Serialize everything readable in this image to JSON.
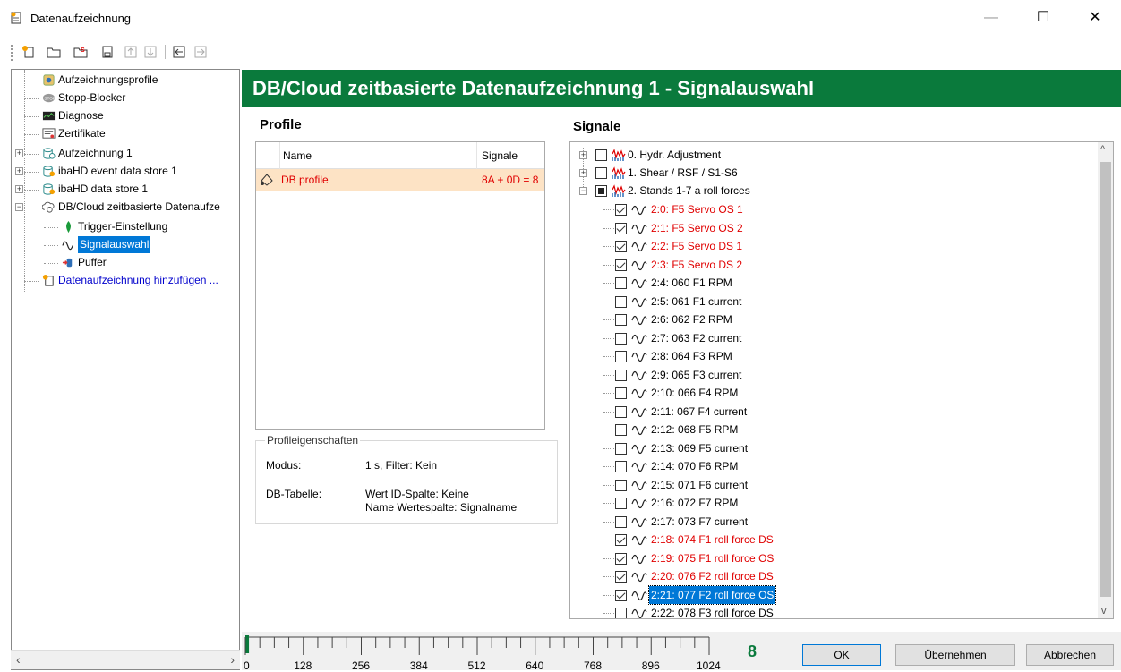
{
  "window": {
    "title": "Datenaufzeichnung",
    "minimize": "—",
    "maximize": "☐",
    "close": "✕"
  },
  "tree": {
    "items": [
      {
        "label": "Aufzeichnungsprofile",
        "color": "#000"
      },
      {
        "label": "Stopp-Blocker",
        "color": "#000"
      },
      {
        "label": "Diagnose",
        "color": "#000"
      },
      {
        "label": "Zertifikate",
        "color": "#000"
      },
      {
        "label": "Aufzeichnung 1",
        "color": "#000"
      },
      {
        "label": "ibaHD event data store 1",
        "color": "#000"
      },
      {
        "label": "ibaHD data store 1",
        "color": "#000"
      },
      {
        "label": "DB/Cloud zeitbasierte Datenaufze",
        "color": "#000"
      },
      {
        "label": "Trigger-Einstellung",
        "color": "#000"
      },
      {
        "label": "Signalauswahl",
        "color": "#fff"
      },
      {
        "label": "Puffer",
        "color": "#000"
      },
      {
        "label": "Datenaufzeichnung hinzufügen ...",
        "color": "#0000cc"
      }
    ]
  },
  "header": {
    "title": "DB/Cloud zeitbasierte Datenaufzeichnung 1 - Signalauswahl"
  },
  "profile": {
    "section_title": "Profile",
    "col_name": "Name",
    "col_signals": "Signale",
    "row": {
      "name": "DB profile",
      "signals": "8A + 0D = 8"
    }
  },
  "properties": {
    "legend": "Profileigenschaften",
    "mode_label": "Modus:",
    "mode_value": "1 s, Filter: Kein",
    "db_label": "DB-Tabelle:",
    "db_value_1": "Wert ID-Spalte: Keine",
    "db_value_2": "Name Wertespalte: Signalname"
  },
  "signals": {
    "section_title": "Signale",
    "groups": [
      {
        "label": "0. Hydr. Adjustment"
      },
      {
        "label": "1. Shear / RSF / S1-S6"
      },
      {
        "label": "2. Stands 1-7  a  roll forces"
      }
    ],
    "items": [
      {
        "label": "2:0: F5 Servo OS 1",
        "checked": true
      },
      {
        "label": "2:1: F5 Servo OS 2",
        "checked": true
      },
      {
        "label": "2:2: F5 Servo  DS 1",
        "checked": true
      },
      {
        "label": "2:3: F5 Servo DS 2",
        "checked": true
      },
      {
        "label": "2:4: 060 F1 RPM",
        "checked": false
      },
      {
        "label": "2:5: 061 F1 current",
        "checked": false
      },
      {
        "label": "2:6: 062 F2 RPM",
        "checked": false
      },
      {
        "label": "2:7: 063 F2 current",
        "checked": false
      },
      {
        "label": "2:8: 064 F3 RPM",
        "checked": false
      },
      {
        "label": "2:9: 065 F3 current",
        "checked": false
      },
      {
        "label": "2:10: 066 F4 RPM",
        "checked": false
      },
      {
        "label": "2:11: 067 F4 current",
        "checked": false
      },
      {
        "label": "2:12: 068 F5 RPM",
        "checked": false
      },
      {
        "label": "2:13: 069 F5 current",
        "checked": false
      },
      {
        "label": "2:14: 070 F6 RPM",
        "checked": false
      },
      {
        "label": "2:15: 071 F6 current",
        "checked": false
      },
      {
        "label": "2:16: 072 F7 RPM",
        "checked": false
      },
      {
        "label": "2:17: 073 F7 current",
        "checked": false
      },
      {
        "label": "2:18: 074 F1 roll force DS",
        "checked": true
      },
      {
        "label": "2:19: 075 F1 roll force OS",
        "checked": true
      },
      {
        "label": "2:20: 076 F2 roll force DS",
        "checked": true
      },
      {
        "label": "2:21: 077 F2 roll force OS",
        "checked": true,
        "selected": true
      },
      {
        "label": "2:22: 078 F3 roll force DS",
        "checked": false
      }
    ]
  },
  "ruler": {
    "ticks": [
      "0",
      "128",
      "256",
      "384",
      "512",
      "640",
      "768",
      "896",
      "1024"
    ],
    "count": "8",
    "fill_fraction": 0.0078
  },
  "buttons": {
    "ok": "OK",
    "apply": "Übernehmen",
    "cancel": "Abbrechen"
  },
  "colors": {
    "header_green": "#0a7a3c",
    "checked_red": "#e00000",
    "selection_blue": "#0078d7",
    "profile_row_bg": "#fde3c5",
    "count_green": "#0a7a3c"
  }
}
